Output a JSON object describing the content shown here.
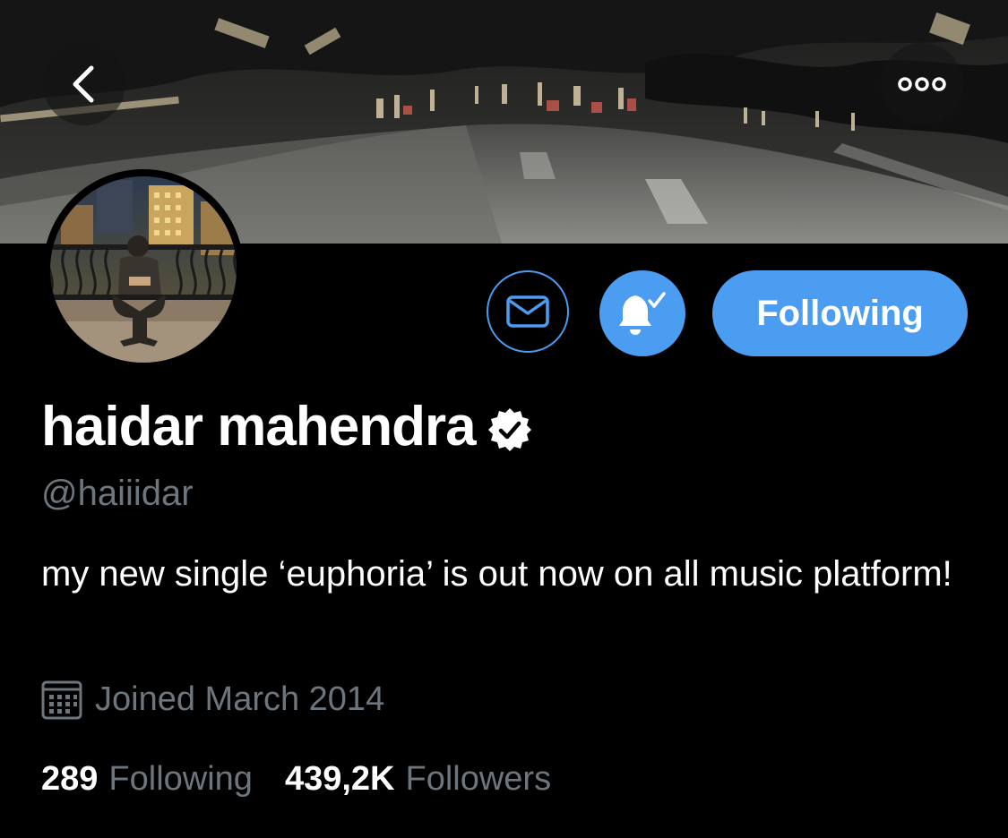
{
  "profile": {
    "display_name": "haidar mahendra",
    "handle": "@haiiidar",
    "bio": "my new single ‘euphoria’ is out now on all music platform!",
    "joined": "Joined March 2014"
  },
  "actions": {
    "follow_label": "Following"
  },
  "stats": {
    "following_count": "289",
    "following_label": "Following",
    "followers_count": "439,2K",
    "followers_label": "Followers"
  },
  "icons": {
    "back": "chevron-left-icon",
    "more": "more-dots-icon",
    "message": "envelope-icon",
    "notifications": "bell-check-icon",
    "verified": "verified-badge-icon",
    "calendar": "calendar-icon"
  },
  "colors": {
    "accent": "#4a9df0",
    "background": "#000000",
    "secondary_text": "#6e767d",
    "primary_text": "#ffffff"
  }
}
